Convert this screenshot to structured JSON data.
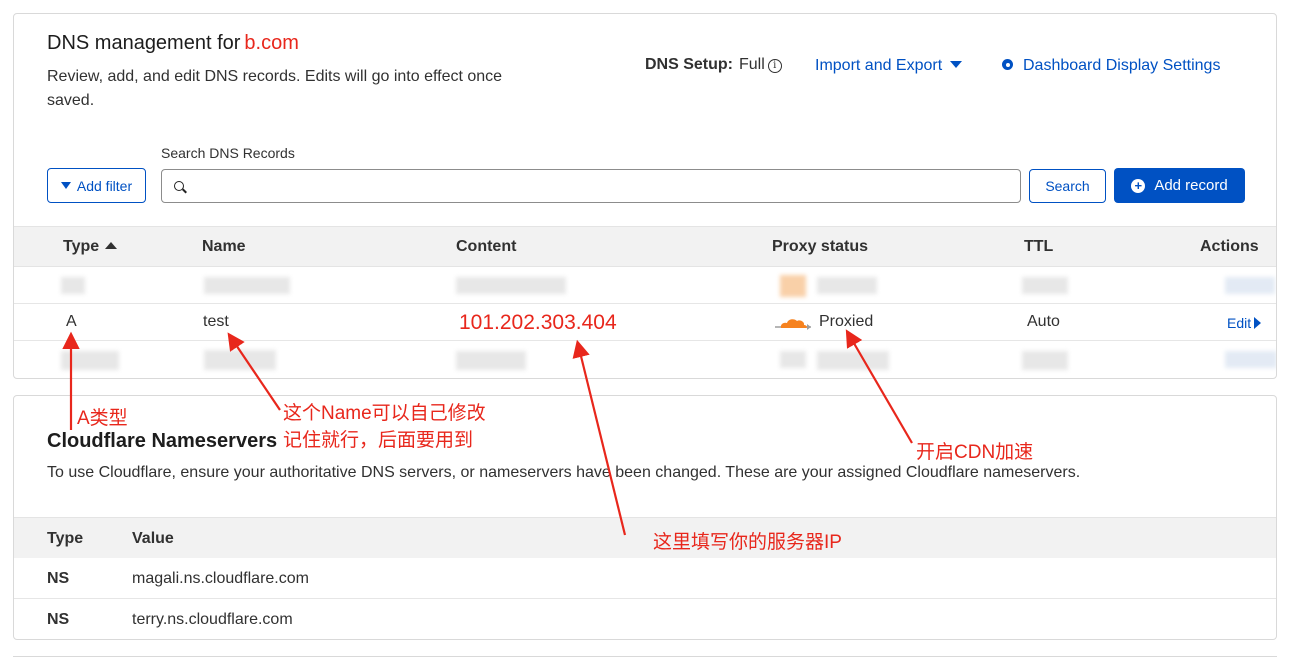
{
  "header": {
    "title": "DNS management for",
    "domain": "b.com",
    "description": "Review, add, and edit DNS records. Edits will go into effect once saved.",
    "setup_label": "DNS Setup:",
    "setup_value": "Full",
    "import_export": "Import and Export",
    "display_settings": "Dashboard Display Settings"
  },
  "toolbar": {
    "add_filter": "Add filter",
    "search_label": "Search DNS Records",
    "search_value": "",
    "search_button": "Search",
    "add_record": "Add record"
  },
  "table": {
    "columns": [
      "Type",
      "Name",
      "Content",
      "Proxy status",
      "TTL",
      "Actions"
    ],
    "record": {
      "type": "A",
      "name": "test",
      "content": "101.202.303.404",
      "proxy_status": "Proxied",
      "ttl": "Auto",
      "action": "Edit"
    }
  },
  "nameservers": {
    "title": "Cloudflare Nameservers",
    "description": "To use Cloudflare, ensure your authoritative DNS servers, or nameservers have been changed. These are your assigned Cloudflare nameservers.",
    "columns": [
      "Type",
      "Value"
    ],
    "rows": [
      {
        "type": "NS",
        "value": "magali.ns.cloudflare.com"
      },
      {
        "type": "NS",
        "value": "terry.ns.cloudflare.com"
      }
    ]
  },
  "annotations": {
    "type_note": "A类型",
    "name_note_1": "这个Name可以自己修改",
    "name_note_2": "记住就行，后面要用到",
    "cdn_note": "开启CDN加速",
    "ip_note": "这里填写你的服务器IP"
  },
  "colors": {
    "accent": "#0051c3",
    "annotation": "#e8271c",
    "cloud": "#f6821f"
  }
}
